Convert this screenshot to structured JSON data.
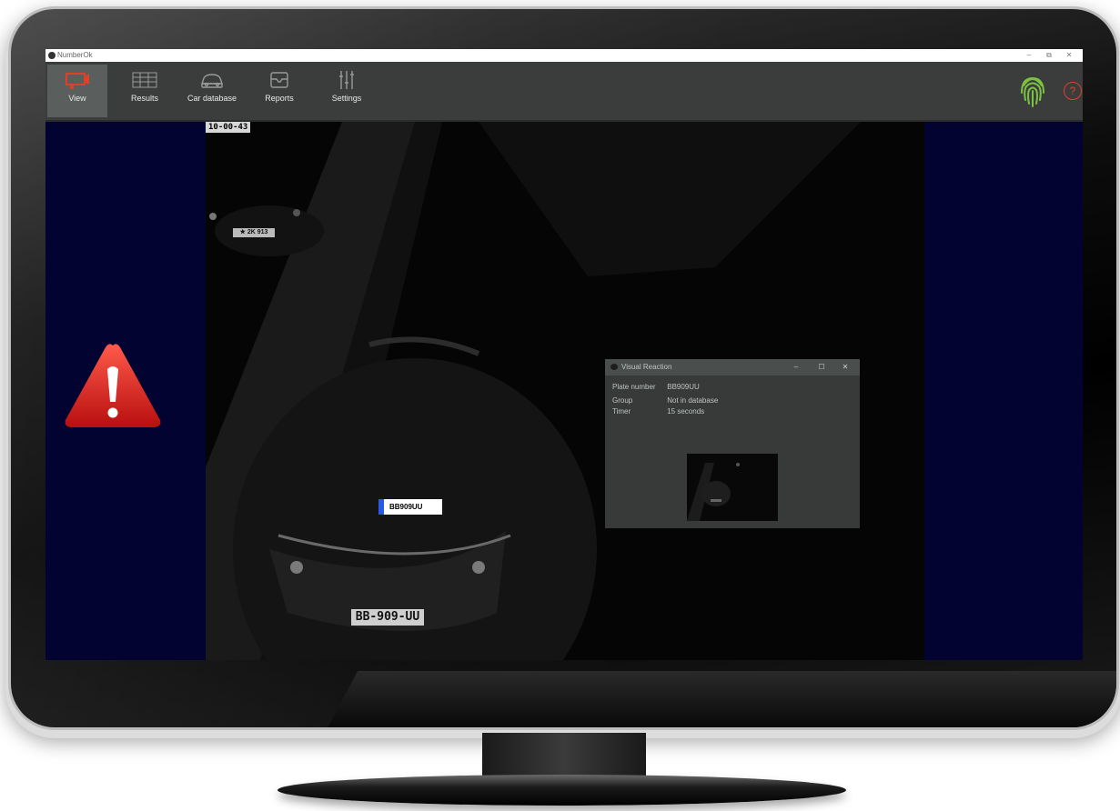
{
  "window": {
    "title": "NumberOk",
    "minimize": "–",
    "maximize": "⧉",
    "close": "✕"
  },
  "toolbar": {
    "items": [
      {
        "label": "View",
        "icon": "camera-view-icon",
        "active": true
      },
      {
        "label": "Results",
        "icon": "results-grid-icon",
        "active": false
      },
      {
        "label": "Car database",
        "icon": "car-icon",
        "active": false
      },
      {
        "label": "Reports",
        "icon": "reports-box-icon",
        "active": false
      },
      {
        "label": "Settings",
        "icon": "sliders-icon",
        "active": false
      }
    ],
    "help_symbol": "?"
  },
  "camera": {
    "timestamp": "10-00-43",
    "detected_plate": "BB909UU",
    "plate_big": "BB-909-UU",
    "plate_small": "★ 2K 913"
  },
  "dialog": {
    "title": "Visual Reaction",
    "minimize": "–",
    "maximize": "☐",
    "close": "✕",
    "rows": [
      {
        "key": "Plate number",
        "value": "BB909UU"
      },
      {
        "key": "Group",
        "value": "Not in database"
      },
      {
        "key": "Timer",
        "value": "15 seconds"
      }
    ]
  },
  "colors": {
    "accent_active": "#e0402a",
    "fingerprint": "#7cc243",
    "side_panel": "#020331",
    "toolbar": "#3a3d3c"
  }
}
